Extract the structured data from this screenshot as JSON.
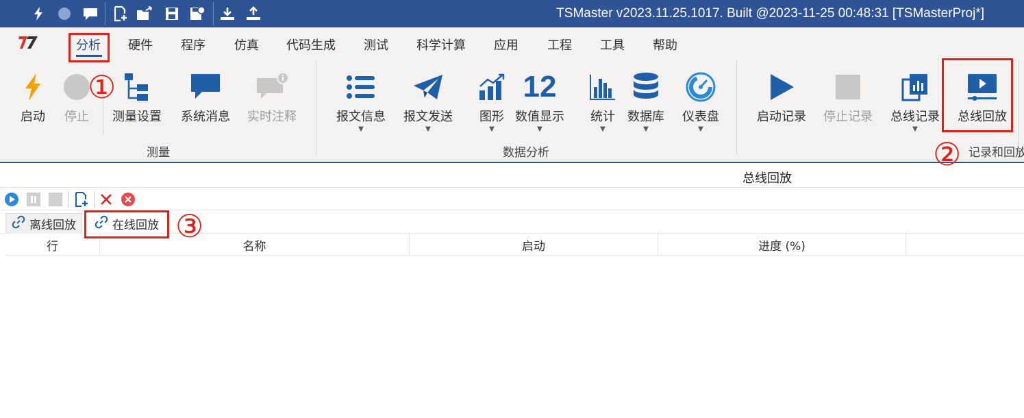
{
  "window": {
    "title": "TSMaster v2023.11.25.1017. Built @2023-11-25 00:48:31 [TSMasterProj*]"
  },
  "quick_access": [
    "lightning-icon",
    "record-dot-icon",
    "message-icon",
    "new-file-icon",
    "open-folder-icon",
    "save-icon",
    "save-as-icon",
    "import-icon",
    "export-icon"
  ],
  "menu": {
    "tabs": [
      "分析",
      "硬件",
      "程序",
      "仿真",
      "代码生成",
      "测试",
      "科学计算",
      "应用",
      "工程",
      "工具",
      "帮助"
    ],
    "active": "分析"
  },
  "ribbon": {
    "groups": [
      {
        "label": "测量",
        "buttons": [
          {
            "label": "启动",
            "icon": "lightning-icon",
            "enabled": true
          },
          {
            "label": "停止",
            "icon": "stop-circle-icon",
            "enabled": false
          },
          {
            "label": "测量设置",
            "icon": "tree-icon",
            "enabled": true
          },
          {
            "label": "系统消息",
            "icon": "chat-bubble-icon",
            "enabled": true
          },
          {
            "label": "实时注释",
            "icon": "comment-info-icon",
            "enabled": false
          }
        ]
      },
      {
        "label": "数据分析",
        "buttons": [
          {
            "label": "报文信息",
            "icon": "list-icon",
            "dropdown": true
          },
          {
            "label": "报文发送",
            "icon": "paper-plane-icon",
            "dropdown": true
          },
          {
            "label": "图形",
            "icon": "chart-trend-icon",
            "dropdown": true
          },
          {
            "label": "数值显示",
            "icon": "numeric-icon",
            "glyph": "12",
            "dropdown": true
          },
          {
            "label": "统计",
            "icon": "bar-chart-icon",
            "dropdown": true
          },
          {
            "label": "数据库",
            "icon": "database-icon",
            "dropdown": true
          },
          {
            "label": "仪表盘",
            "icon": "gauge-icon",
            "dropdown": true
          }
        ]
      },
      {
        "label": "记录和回放",
        "buttons": [
          {
            "label": "启动记录",
            "icon": "play-icon",
            "enabled": true
          },
          {
            "label": "停止记录",
            "icon": "stop-square-icon",
            "enabled": false
          },
          {
            "label": "总线记录",
            "icon": "bus-record-icon",
            "dropdown": true
          },
          {
            "label": "总线回放",
            "icon": "bus-replay-icon",
            "enabled": true
          }
        ]
      }
    ]
  },
  "panel": {
    "title": "总线回放",
    "toolbar": [
      "play-icon",
      "pause-icon",
      "stop-icon",
      "add-icon",
      "delete-icon",
      "clear-icon"
    ],
    "tabs": [
      {
        "label": "离线回放",
        "icon": "link-icon"
      },
      {
        "label": "在线回放",
        "icon": "link-icon"
      }
    ],
    "columns": [
      "行",
      "名称",
      "启动",
      "进度 (%)"
    ]
  },
  "annotations": {
    "step1": "①",
    "step2": "②",
    "step3": "③",
    "color": "#e0201b"
  },
  "colors": {
    "title_bar": "#2f5496",
    "accent_blue": "#1f5fa8",
    "ribbon_bg": "#f3f2f1",
    "lightning": "#f0a30a"
  }
}
